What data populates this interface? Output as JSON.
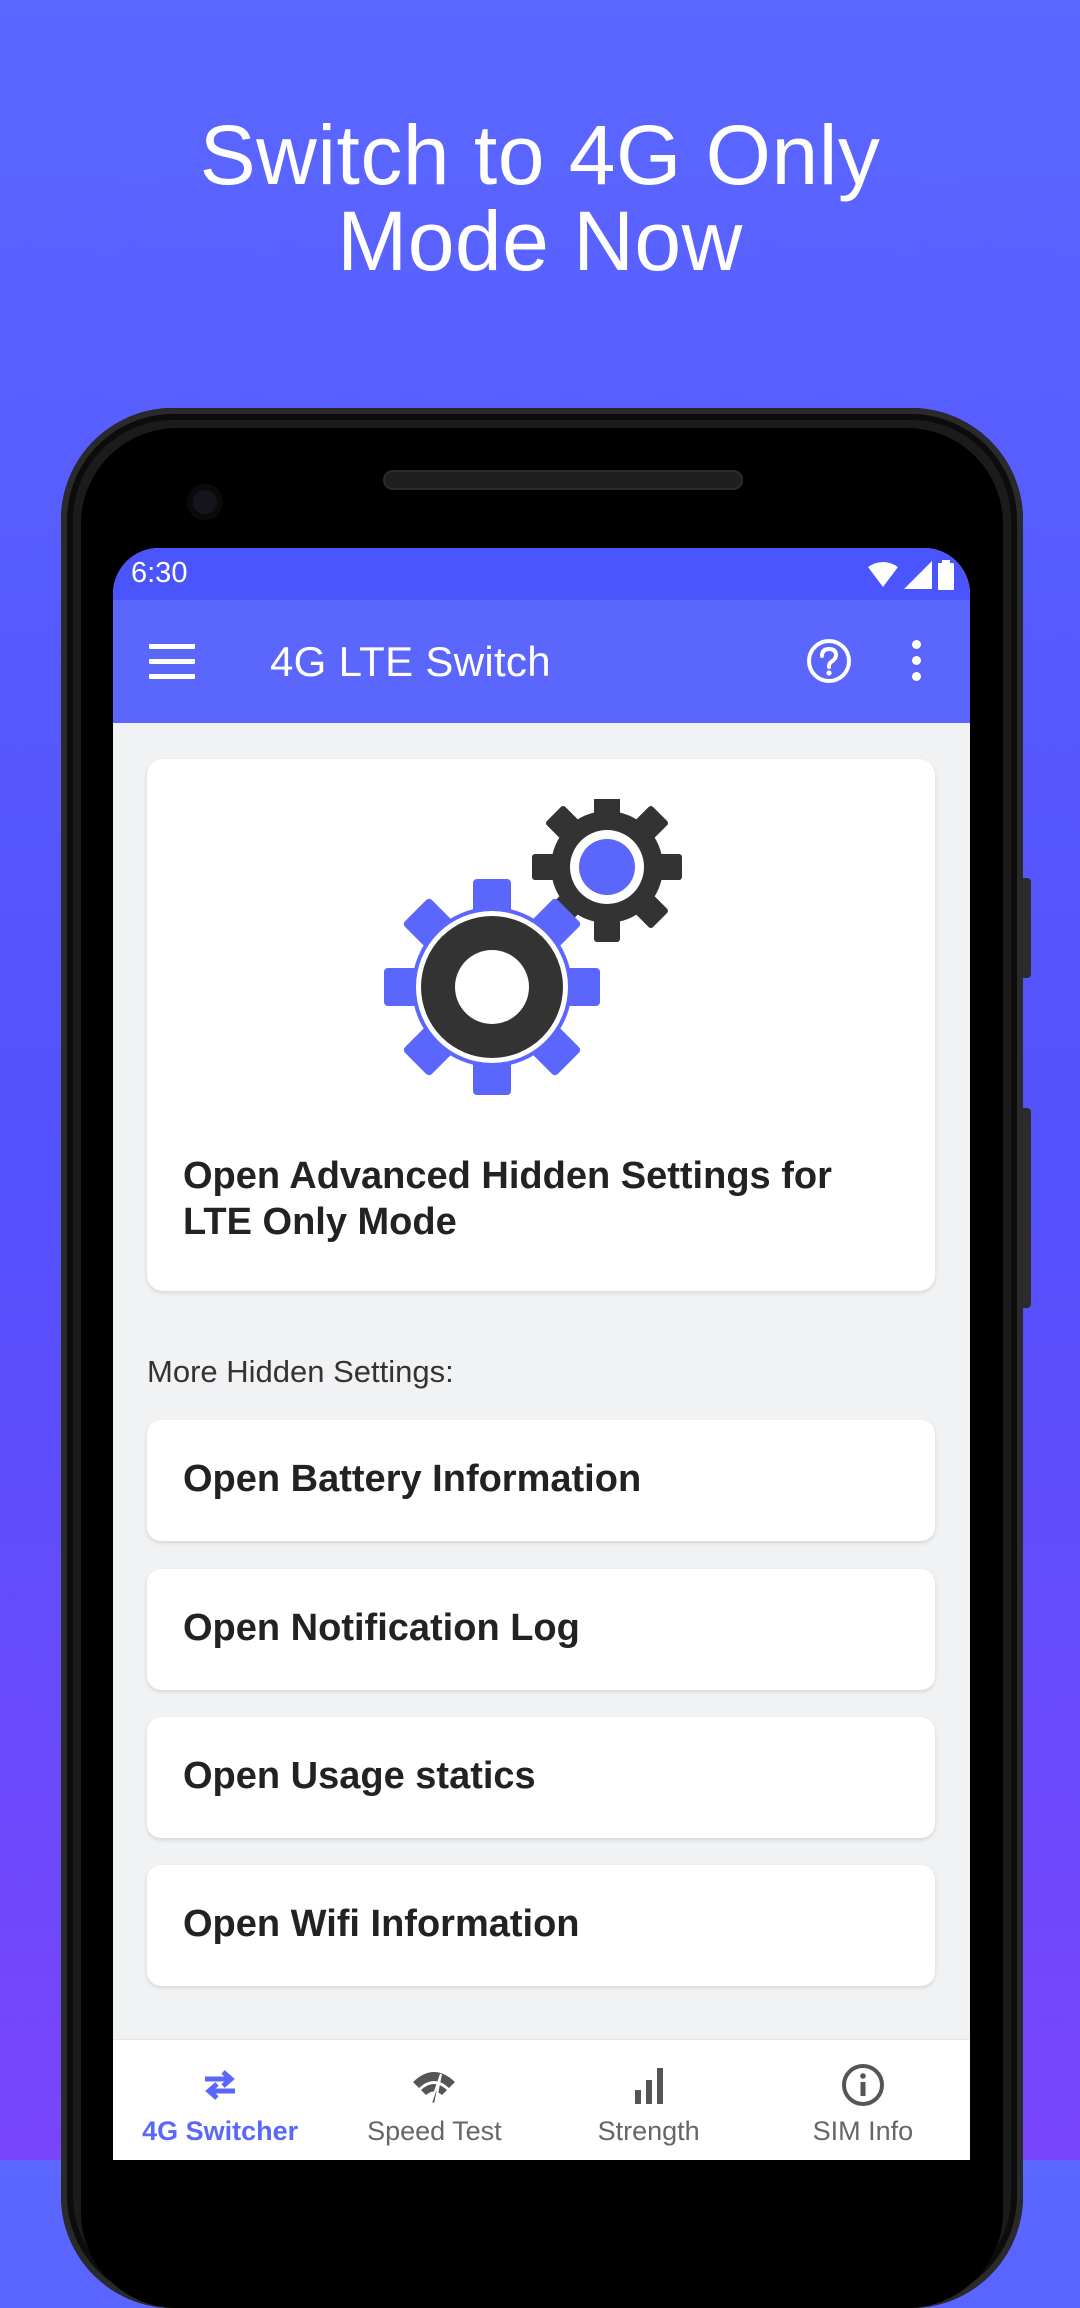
{
  "promo": {
    "headline_line1": "Switch to 4G Only",
    "headline_line2": "Mode Now"
  },
  "status_bar": {
    "time": "6:30",
    "icons": [
      "wifi-icon",
      "signal-icon",
      "battery-icon"
    ]
  },
  "app_bar": {
    "title": "4G LTE Switch",
    "icons": [
      "menu-icon",
      "help-icon",
      "more-vert-icon"
    ]
  },
  "hero_card": {
    "icon": "gears-icon",
    "label": "Open Advanced Hidden Settings for LTE Only Mode"
  },
  "section_label": "More Hidden Settings:",
  "items": [
    {
      "label": "Open Battery Information"
    },
    {
      "label": "Open Notification Log"
    },
    {
      "label": "Open Usage statics"
    },
    {
      "label": "Open Wifi Information"
    }
  ],
  "bottom_nav": {
    "active_index": 0,
    "items": [
      {
        "label": "4G Switcher",
        "icon": "swap-arrows-icon"
      },
      {
        "label": "Speed Test",
        "icon": "speedometer-icon"
      },
      {
        "label": "Strength",
        "icon": "signal-bars-icon"
      },
      {
        "label": "SIM Info",
        "icon": "info-icon"
      }
    ]
  },
  "colors": {
    "accent": "#5b66fd",
    "status_bar": "#4b55fd",
    "gear_dark": "#333333",
    "background_top": "#5b67ff",
    "background_bottom": "#7a45fb"
  }
}
